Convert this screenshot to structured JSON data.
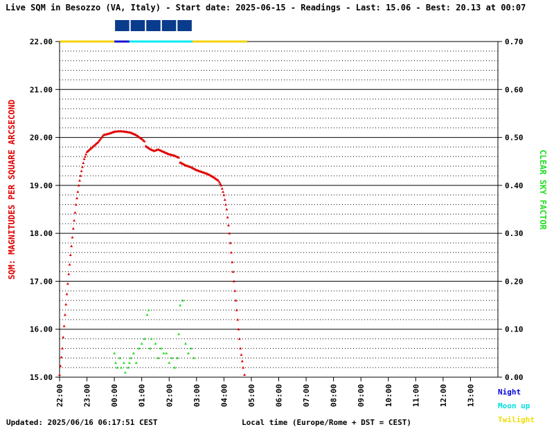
{
  "header": {
    "title": "Live SQM in Besozzo (VA, Italy) - Start date: 2025-06-15 - Readings - Last: 15.06 - Best: 20.13 at 00:07"
  },
  "footer": {
    "updated": "Updated: 2025/06/16 06:17:51 CEST",
    "local_time": "Local time (Europe/Rome + DST = CEST)"
  },
  "legend": {
    "night": "Night",
    "moon_up": "Moon up",
    "twilight": "Twilight"
  },
  "colors": {
    "sqm": "#e00000",
    "clear_sky": "#22dd22",
    "night": "#1010d0",
    "moon_up": "#00e8ee",
    "twilight": "#f2d200",
    "moon_blocks": "#0a3c8c"
  },
  "chart_data": {
    "type": "scatter",
    "ylabel": "SQM: MAGNITUDES PER SQUARE ARCSECOND",
    "y2label": "CLEAR SKY FACTOR",
    "x_ticks": [
      "22:00",
      "23:00",
      "00:00",
      "01:00",
      "02:00",
      "03:00",
      "04:00",
      "05:00",
      "06:00",
      "07:00",
      "08:00",
      "09:00",
      "10:00",
      "11:00",
      "12:00",
      "13:00"
    ],
    "x_range_hours": [
      22,
      38
    ],
    "ylim": [
      15.0,
      22.0
    ],
    "y_ticks": [
      "15.00",
      "16.00",
      "17.00",
      "18.00",
      "19.00",
      "20.00",
      "21.00",
      "22.00"
    ],
    "y2lim": [
      0.0,
      0.7
    ],
    "y2_ticks": [
      "0.00",
      "0.10",
      "0.20",
      "0.30",
      "0.40",
      "0.50",
      "0.60",
      "0.70"
    ],
    "bands": [
      {
        "type": "twilight",
        "start": 22.0,
        "end": 24.0
      },
      {
        "type": "night",
        "start": 24.0,
        "end": 24.55
      },
      {
        "type": "moon_up",
        "start": 24.55,
        "end": 26.85
      },
      {
        "type": "twilight",
        "start": 26.85,
        "end": 28.85
      }
    ],
    "moon_blocks": 5,
    "series": [
      {
        "key": "sqm",
        "axis": "left",
        "points": [
          [
            22.0,
            15.05
          ],
          [
            22.1,
            15.6
          ],
          [
            22.2,
            16.3
          ],
          [
            22.3,
            16.95
          ],
          [
            22.4,
            17.55
          ],
          [
            22.5,
            18.1
          ],
          [
            22.6,
            18.6
          ],
          [
            22.7,
            19.0
          ],
          [
            22.8,
            19.3
          ],
          [
            22.9,
            19.55
          ],
          [
            23.0,
            19.7
          ],
          [
            23.2,
            19.8
          ],
          [
            23.4,
            19.9
          ],
          [
            23.6,
            20.05
          ],
          [
            23.8,
            20.08
          ],
          [
            24.0,
            20.12
          ],
          [
            24.2,
            20.13
          ],
          [
            24.4,
            20.12
          ],
          [
            24.6,
            20.1
          ],
          [
            24.8,
            20.05
          ],
          [
            25.0,
            19.97
          ],
          [
            25.1,
            19.92
          ],
          [
            25.15,
            19.82
          ],
          [
            25.3,
            19.76
          ],
          [
            25.45,
            19.72
          ],
          [
            25.6,
            19.75
          ],
          [
            25.8,
            19.7
          ],
          [
            26.0,
            19.65
          ],
          [
            26.2,
            19.62
          ],
          [
            26.35,
            19.58
          ],
          [
            26.4,
            19.48
          ],
          [
            26.6,
            19.42
          ],
          [
            26.8,
            19.38
          ],
          [
            27.0,
            19.32
          ],
          [
            27.2,
            19.28
          ],
          [
            27.4,
            19.24
          ],
          [
            27.6,
            19.18
          ],
          [
            27.8,
            19.1
          ],
          [
            27.9,
            19.0
          ],
          [
            28.0,
            18.8
          ],
          [
            28.1,
            18.5
          ],
          [
            28.2,
            18.0
          ],
          [
            28.3,
            17.4
          ],
          [
            28.4,
            16.8
          ],
          [
            28.5,
            16.2
          ],
          [
            28.6,
            15.6
          ],
          [
            28.7,
            15.2
          ],
          [
            28.75,
            15.05
          ]
        ]
      },
      {
        "key": "clear_sky",
        "axis": "right",
        "points": [
          [
            24.0,
            0.05
          ],
          [
            24.05,
            0.03
          ],
          [
            24.1,
            0.02
          ],
          [
            24.2,
            0.04
          ],
          [
            24.25,
            0.02
          ],
          [
            24.35,
            0.03
          ],
          [
            24.4,
            0.01
          ],
          [
            24.5,
            0.02
          ],
          [
            24.55,
            0.03
          ],
          [
            24.6,
            0.04
          ],
          [
            24.7,
            0.05
          ],
          [
            24.8,
            0.03
          ],
          [
            24.9,
            0.06
          ],
          [
            25.0,
            0.07
          ],
          [
            25.1,
            0.08
          ],
          [
            25.2,
            0.13
          ],
          [
            25.25,
            0.14
          ],
          [
            25.3,
            0.06
          ],
          [
            25.35,
            0.08
          ],
          [
            25.5,
            0.07
          ],
          [
            25.6,
            0.04
          ],
          [
            25.7,
            0.06
          ],
          [
            25.8,
            0.05
          ],
          [
            25.9,
            0.05
          ],
          [
            26.0,
            0.03
          ],
          [
            26.1,
            0.04
          ],
          [
            26.2,
            0.02
          ],
          [
            26.3,
            0.04
          ],
          [
            26.35,
            0.09
          ],
          [
            26.4,
            0.15
          ],
          [
            26.5,
            0.16
          ],
          [
            26.6,
            0.07
          ],
          [
            26.7,
            0.05
          ],
          [
            26.8,
            0.06
          ],
          [
            26.9,
            0.04
          ]
        ]
      }
    ]
  }
}
